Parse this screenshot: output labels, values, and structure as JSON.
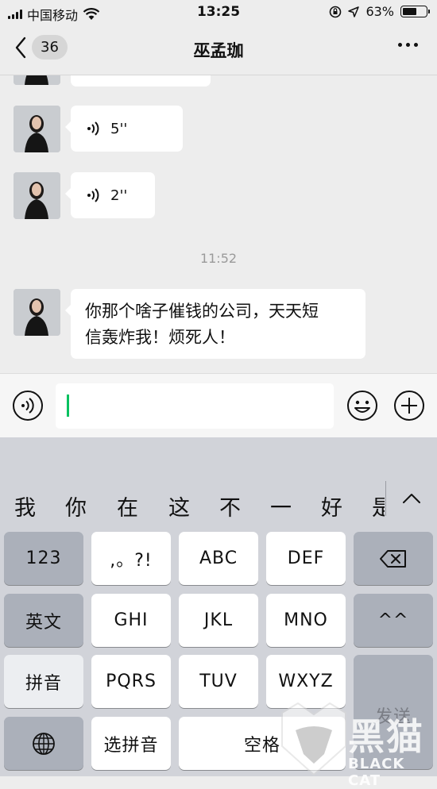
{
  "status_bar": {
    "carrier": "中国移动",
    "time": "13:25",
    "battery": "63%",
    "battery_level": 0.63
  },
  "nav": {
    "back_count": "36",
    "title": "巫孟珈"
  },
  "messages": [
    {
      "type": "voice",
      "duration": "5''"
    },
    {
      "type": "voice",
      "duration": "2''"
    }
  ],
  "timestamp": "11:52",
  "text_message": {
    "line1": "你那个啥子催钱的公司，天天短",
    "line2": "信轰炸我！烦死人！"
  },
  "keyboard": {
    "candidates": [
      "我",
      "你",
      "在",
      "这",
      "不",
      "一",
      "好",
      "是"
    ],
    "row1": {
      "num": "123",
      "punct": ",。?!",
      "k2": "ABC",
      "k3": "DEF"
    },
    "row2": {
      "lang": "英文",
      "k4": "GHI",
      "k5": "JKL",
      "k6": "MNO",
      "emoji": "^^"
    },
    "row3": {
      "pinyin": "拼音",
      "k7": "PQRS",
      "k8": "TUV",
      "k9": "WXYZ"
    },
    "row4": {
      "select": "选拼音",
      "space": "空格",
      "send": "发送"
    }
  },
  "watermark": {
    "cn": "黑猫",
    "en": "BLACK CAT"
  },
  "colors": {
    "background": "#ededed",
    "bubble": "#ffffff",
    "caret": "#07c160",
    "keyboard": "#d1d3d9",
    "key_dark": "#abb0ba"
  }
}
